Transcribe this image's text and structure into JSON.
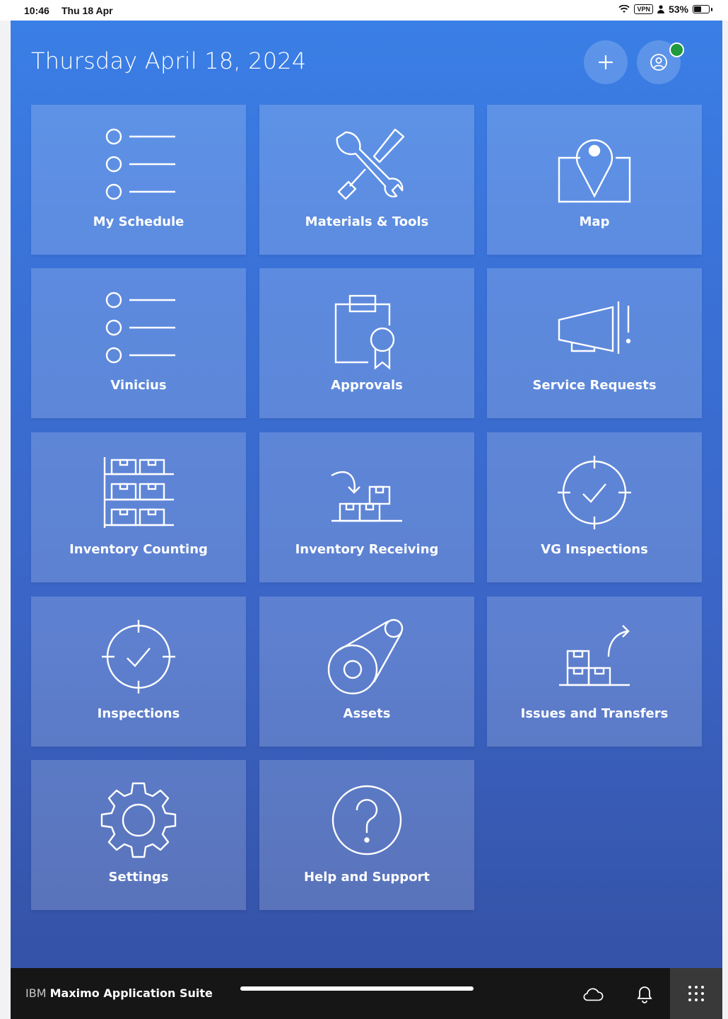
{
  "status_bar": {
    "time": "10:46",
    "date": "Thu 18 Apr",
    "vpn": "VPN",
    "battery": "53%",
    "battery_level": 0.53
  },
  "header": {
    "date_title": "Thursday April 18, 2024",
    "online_status_color": "#1f9a3c"
  },
  "tiles": [
    {
      "label": "My Schedule",
      "icon": "list-icon"
    },
    {
      "label": "Materials & Tools",
      "icon": "tools-icon"
    },
    {
      "label": "Map",
      "icon": "map-pin-icon"
    },
    {
      "label": "Vinicius",
      "icon": "list-icon"
    },
    {
      "label": "Approvals",
      "icon": "clipboard-badge-icon"
    },
    {
      "label": "Service Requests",
      "icon": "megaphone-icon"
    },
    {
      "label": "Inventory Counting",
      "icon": "shelves-icon"
    },
    {
      "label": "Inventory Receiving",
      "icon": "receiving-icon"
    },
    {
      "label": "VG Inspections",
      "icon": "target-check-icon"
    },
    {
      "label": "Inspections",
      "icon": "target-check-icon"
    },
    {
      "label": "Assets",
      "icon": "asset-icon"
    },
    {
      "label": "Issues and Transfers",
      "icon": "transfer-icon"
    },
    {
      "label": "Settings",
      "icon": "gear-icon"
    },
    {
      "label": "Help and Support",
      "icon": "help-icon"
    }
  ],
  "footer": {
    "brand_prefix": "IBM",
    "brand_name": "Maximo Application Suite"
  }
}
